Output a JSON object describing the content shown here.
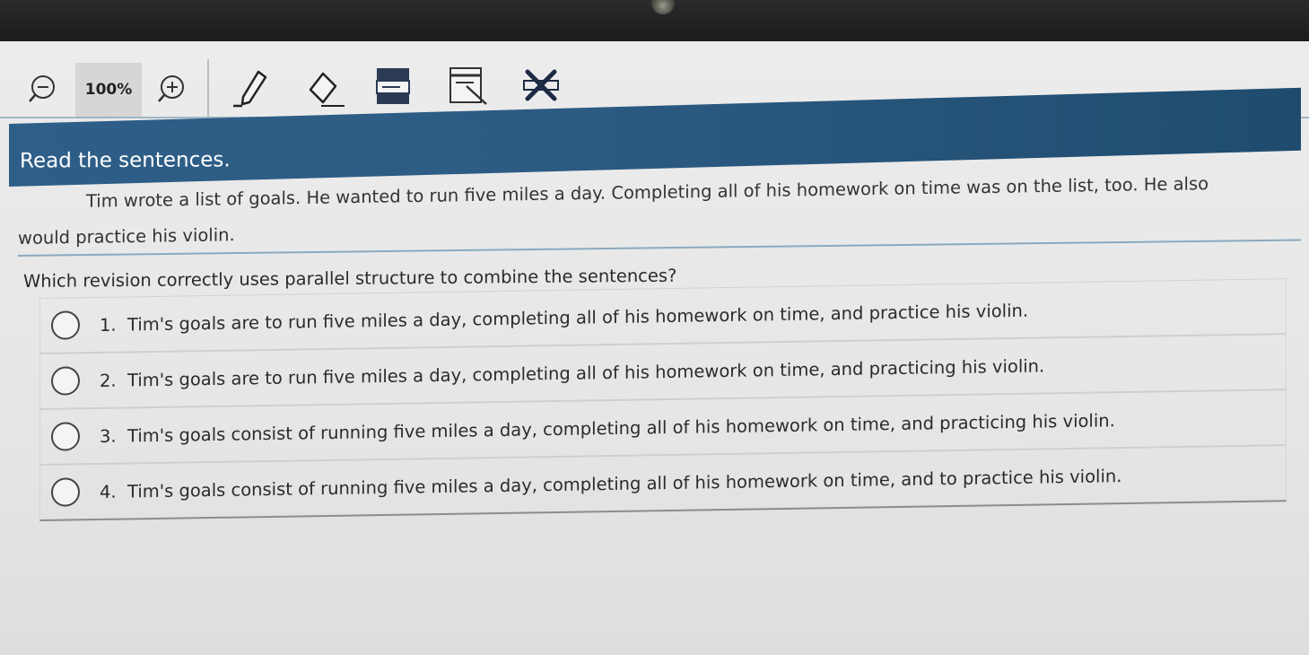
{
  "toolbar": {
    "zoom_level": "100%",
    "tools": [
      "zoom-out-icon",
      "zoom-in-icon",
      "pen-icon",
      "eraser-icon",
      "answer-masking-icon",
      "line-reader-icon",
      "answer-eliminator-icon"
    ]
  },
  "header": {
    "title": "Read the sentences."
  },
  "passage": {
    "text": "Tim wrote a list of goals. He wanted to run five miles a day. Completing all of his homework on time was on the list, too. He also would practice his violin."
  },
  "question": {
    "prompt": "Which revision correctly uses parallel structure to combine the sentences?"
  },
  "options": [
    {
      "number": "1.",
      "text": "Tim's goals are to run five miles a day, completing all of his homework on time, and practice his violin."
    },
    {
      "number": "2.",
      "text": "Tim's goals are to run five miles a day, completing all of his homework on time, and practicing his violin."
    },
    {
      "number": "3.",
      "text": "Tim's goals consist of running five miles a day, completing all of his homework on time, and practicing his violin."
    },
    {
      "number": "4.",
      "text": "Tim's goals consist of running five miles a day, completing all of his homework on time, and to practice his violin."
    }
  ]
}
